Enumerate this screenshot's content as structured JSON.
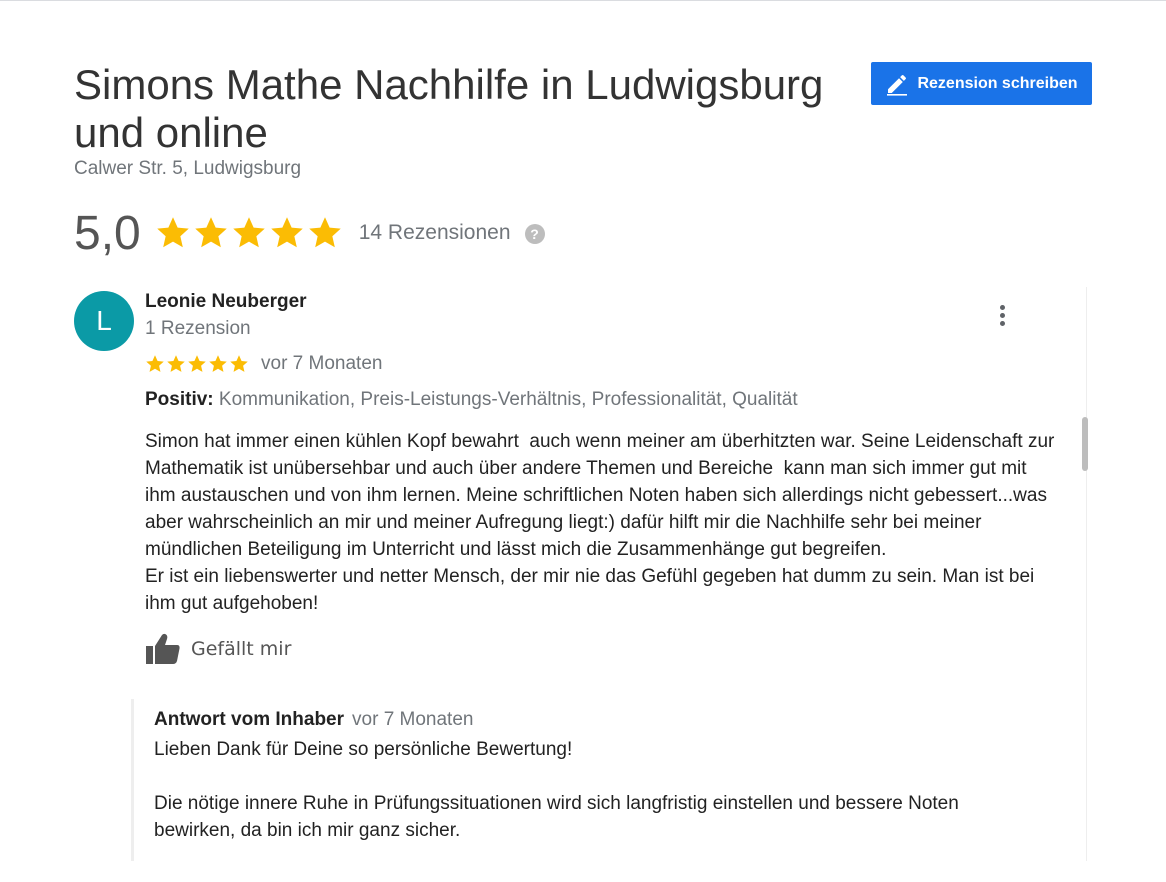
{
  "business": {
    "title": "Simons Mathe Nachhilfe in Ludwigsburg und online",
    "address": "Calwer Str. 5, Ludwigsburg",
    "write_review_label": "Rezension schreiben",
    "rating": "5,0",
    "stars_filled": 5,
    "review_count_label": "14 Rezensionen",
    "help_glyph": "?"
  },
  "colors": {
    "accent": "#1a73e8",
    "star": "#fbbc04",
    "avatar": "#0b9aa6"
  },
  "icons": {
    "write": "pencil-icon",
    "help": "question-mark-icon",
    "more": "more-vertical-icon",
    "like": "thumbs-up-icon",
    "star": "star-icon"
  },
  "review": {
    "avatar_letter": "L",
    "reviewer_name": "Leonie Neuberger",
    "reviewer_meta": "1 Rezension",
    "stars": 5,
    "date": "vor 7 Monaten",
    "positive_label": "Positiv:",
    "positive_items": " Kommunikation, Preis-Leistungs-Verhältnis, Professionalität, Qualität",
    "text": "Simon hat immer einen kühlen Kopf bewahrt  auch wenn meiner am überhitzten war. Seine Leidenschaft zur Mathematik ist unübersehbar und auch über andere Themen und Bereiche  kann man sich immer gut mit ihm austauschen und von ihm lernen. Meine schriftlichen Noten haben sich allerdings nicht gebessert...was aber wahrscheinlich an mir und meiner Aufregung liegt:) dafür hilft mir die Nachhilfe sehr bei meiner mündlichen Beteiligung im Unterricht und lässt mich die Zusammenhänge gut begreifen.\nEr ist ein liebenswerter und netter Mensch, der mir nie das Gefühl gegeben hat dumm zu sein. Man ist bei ihm gut aufgehoben!",
    "like_label": "Gefällt mir"
  },
  "owner_reply": {
    "label": "Antwort vom Inhaber",
    "date": "vor 7 Monaten",
    "text": "Lieben Dank für Deine so persönliche Bewertung!\n\nDie nötige innere Ruhe in Prüfungssituationen wird sich langfristig einstellen und bessere Noten bewirken, da bin ich mir ganz sicher."
  }
}
